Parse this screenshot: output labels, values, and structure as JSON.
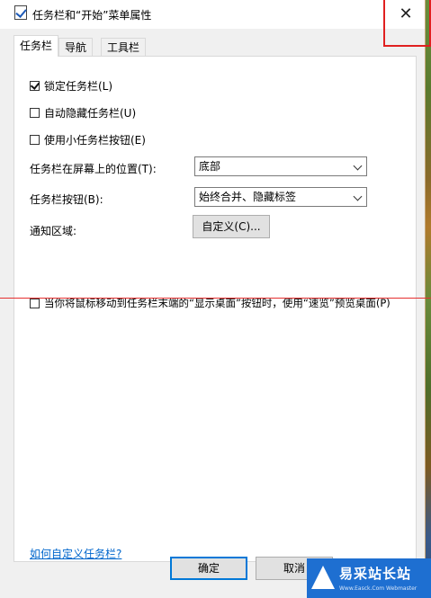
{
  "window": {
    "title": "任务栏和“开始”菜单属性",
    "close_glyph": "✕"
  },
  "tabs": [
    {
      "label": "任务栏",
      "active": true
    },
    {
      "label": "导航",
      "active": false
    },
    {
      "label": "工具栏",
      "active": false
    }
  ],
  "options": {
    "lock_taskbar": {
      "label": "锁定任务栏(L)",
      "checked": true
    },
    "auto_hide": {
      "label": "自动隐藏任务栏(U)",
      "checked": false
    },
    "small_buttons": {
      "label": "使用小任务栏按钮(E)",
      "checked": false
    }
  },
  "position": {
    "label": "任务栏在屏幕上的位置(T):",
    "value": "底部"
  },
  "buttons_combine": {
    "label": "任务栏按钮(B):",
    "value": "始终合并、隐藏标签"
  },
  "notification": {
    "label": "通知区域:",
    "button": "自定义(C)..."
  },
  "peek": {
    "label": "当你将鼠标移动到任务栏末端的“显示桌面”按钮时，使用“速览”预览桌面(P)",
    "checked": false
  },
  "help_link": "如何自定义任务栏?",
  "footer": {
    "ok": "确定",
    "cancel": "取消"
  },
  "watermark": {
    "text": "易采站长站",
    "sub": "Www.Easck.Com Webmaster"
  },
  "colors": {
    "accent": "#0078d7",
    "link": "#0066cc",
    "annotation": "#e02020"
  }
}
